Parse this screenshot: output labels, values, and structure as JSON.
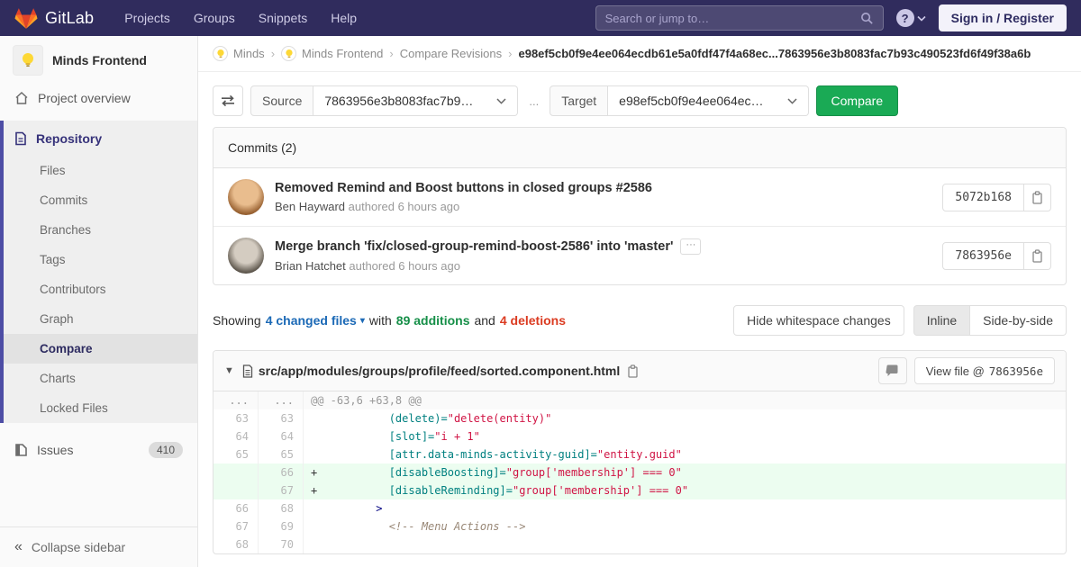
{
  "navbar": {
    "brand": "GitLab",
    "menu": [
      "Projects",
      "Groups",
      "Snippets",
      "Help"
    ],
    "search_placeholder": "Search or jump to…",
    "help_glyph": "?",
    "signin_label": "Sign in / Register"
  },
  "sidebar": {
    "project_name": "Minds Frontend",
    "overview_label": "Project overview",
    "repository_label": "Repository",
    "repo_items": [
      "Files",
      "Commits",
      "Branches",
      "Tags",
      "Contributors",
      "Graph",
      "Compare",
      "Charts",
      "Locked Files"
    ],
    "active_item": "Compare",
    "issues_label": "Issues",
    "issues_count": "410",
    "collapse_glyph": "«",
    "collapse_label": "Collapse sidebar"
  },
  "breadcrumb": {
    "separator": "›",
    "items": [
      "Minds",
      "Minds Frontend",
      "Compare Revisions"
    ],
    "current": "e98ef5cb0f9e4ee064ecdb61e5a0fdf47f4a68ec...7863956e3b8083fac7b93c490523fd6f49f38a6b"
  },
  "compare_form": {
    "source_label": "Source",
    "source_value": "7863956e3b8083fac7b9…",
    "separator": "...",
    "target_label": "Target",
    "target_value": "e98ef5cb0f9e4ee064ec…",
    "compare_button": "Compare"
  },
  "commits": {
    "header": "Commits (2)",
    "items": [
      {
        "title": "Removed Remind and Boost buttons in closed groups #2586",
        "author": "Ben Hayward",
        "meta": " authored 6 hours ago",
        "sha": "5072b168",
        "expander": ""
      },
      {
        "title": "Merge branch 'fix/closed-group-remind-boost-2586' into 'master'",
        "author": "Brian Hatchet",
        "meta": " authored 6 hours ago",
        "sha": "7863956e",
        "expander": "···"
      }
    ]
  },
  "diff_summary": {
    "showing": "Showing",
    "changed_files": "4 changed files",
    "caret": "▾",
    "with": "with",
    "additions": "89 additions",
    "and": "and",
    "deletions": "4 deletions",
    "hide_whitespace": "Hide whitespace changes",
    "inline": "Inline",
    "side_by_side": "Side-by-side"
  },
  "diff_file": {
    "collapse_caret": "▼",
    "path": "src/app/modules/groups/profile/feed/sorted.component.html",
    "view_file_label": "View file @",
    "view_file_sha": "7863956e",
    "rows": [
      {
        "old": "...",
        "new": "...",
        "type": "hunk",
        "tokens": [
          {
            "c": "hunk",
            "v": "@@ -63,6 +63,8 @@"
          }
        ]
      },
      {
        "old": "63",
        "new": "63",
        "type": "ctx",
        "tokens": [
          {
            "c": "pl",
            "v": "            "
          },
          {
            "c": "attr",
            "v": "(delete)="
          },
          {
            "c": "str",
            "v": "\"delete(entity)\""
          }
        ]
      },
      {
        "old": "64",
        "new": "64",
        "type": "ctx",
        "tokens": [
          {
            "c": "pl",
            "v": "            "
          },
          {
            "c": "attr",
            "v": "[slot]="
          },
          {
            "c": "str",
            "v": "\"i + 1\""
          }
        ]
      },
      {
        "old": "65",
        "new": "65",
        "type": "ctx",
        "tokens": [
          {
            "c": "pl",
            "v": "            "
          },
          {
            "c": "attr",
            "v": "[attr.data-minds-activity-guid]="
          },
          {
            "c": "str",
            "v": "\"entity.guid\""
          }
        ]
      },
      {
        "old": "",
        "new": "66",
        "type": "add",
        "tokens": [
          {
            "c": "pl",
            "v": "+           "
          },
          {
            "c": "attr",
            "v": "[disableBoosting]="
          },
          {
            "c": "str",
            "v": "\"group['membership'] === 0\""
          }
        ]
      },
      {
        "old": "",
        "new": "67",
        "type": "add",
        "tokens": [
          {
            "c": "pl",
            "v": "+           "
          },
          {
            "c": "attr",
            "v": "[disableReminding]="
          },
          {
            "c": "str",
            "v": "\"group['membership'] === 0\""
          }
        ]
      },
      {
        "old": "66",
        "new": "68",
        "type": "ctx",
        "tokens": [
          {
            "c": "pl",
            "v": "          "
          },
          {
            "c": "nt",
            "v": ">"
          }
        ]
      },
      {
        "old": "67",
        "new": "69",
        "type": "ctx",
        "tokens": [
          {
            "c": "pl",
            "v": "            "
          },
          {
            "c": "cm",
            "v": "<!-- Menu Actions -->"
          }
        ]
      },
      {
        "old": "68",
        "new": "70",
        "type": "ctx",
        "tokens": []
      }
    ]
  },
  "colors": {
    "navbar_bg": "#302c5d",
    "accent_green": "#1aaa55",
    "link_blue": "#1b69b6",
    "additions_green": "#168f48",
    "deletions_red": "#db3b21",
    "added_line_bg": "#ecfdf0",
    "sidebar_accent": "#4d4da5"
  }
}
